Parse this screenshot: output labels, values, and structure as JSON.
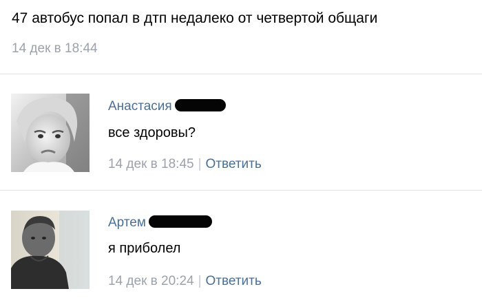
{
  "post": {
    "text": "47 автобус попал в дтп недалеко от четвертой общаги",
    "date": "14 дек в 18:44"
  },
  "comments": [
    {
      "author": "Анастасия",
      "text": "все здоровы?",
      "date": "14 дек в 18:45",
      "separator": "|",
      "reply_label": "Ответить"
    },
    {
      "author": "Артем",
      "text": "я приболел",
      "date": "14 дек в 20:24",
      "separator": "|",
      "reply_label": "Ответить"
    }
  ],
  "colors": {
    "link": "#4a6f95",
    "muted": "#9ca2ab",
    "divider": "#dfe3e8"
  }
}
